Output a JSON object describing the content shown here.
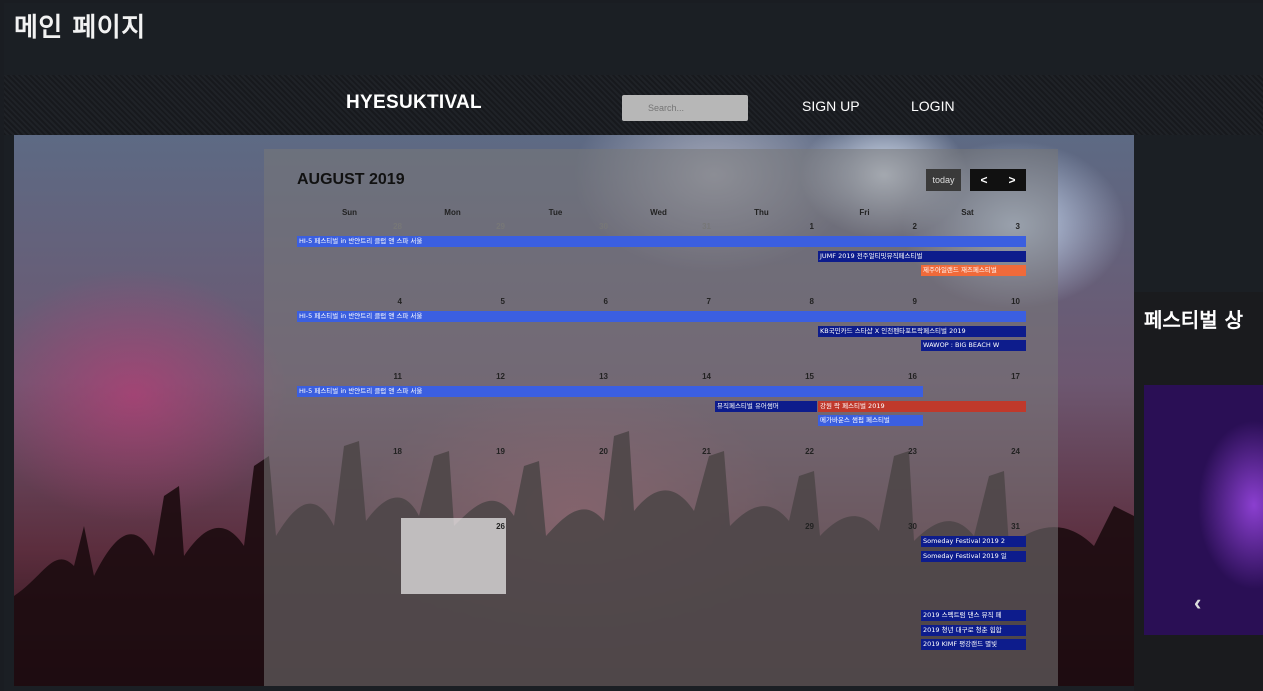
{
  "page": {
    "title": "메인 페이지"
  },
  "nav": {
    "brand": "HYESUKTIVAL",
    "search_placeholder": "Search...",
    "signup": "SIGN UP",
    "login": "LOGIN"
  },
  "calendar": {
    "title": "AUGUST 2019",
    "today_label": "today",
    "prev_label": "<",
    "next_label": ">",
    "weekdays": [
      "Sun",
      "Mon",
      "Tue",
      "Wed",
      "Thu",
      "Fri",
      "Sat"
    ],
    "weeks": [
      [
        "28",
        "29",
        "30",
        "31",
        "1",
        "2",
        "3"
      ],
      [
        "4",
        "5",
        "6",
        "7",
        "8",
        "9",
        "10"
      ],
      [
        "11",
        "12",
        "13",
        "14",
        "15",
        "16",
        "17"
      ],
      [
        "18",
        "19",
        "20",
        "21",
        "22",
        "23",
        "24"
      ],
      [
        "",
        "26",
        "",
        "",
        "29",
        "30",
        "31"
      ]
    ],
    "events": {
      "hi5_w1": "HI-5 페스티벌 in 반얀트리 클럽 앤 스파 서울",
      "jimf_w1": "JUMF 2019 전주얼티밋뮤직페스티벌",
      "jeju_w1": "제주아일랜드 재즈페스티벌",
      "hi5_w2": "HI-5 페스티벌 in 반얀트리 클럽 앤 스파 서울",
      "kor_w2": "KB국민카드 스타샵 X 인천펜타포트락페스티벌 2019",
      "wawop_w2": "WAWOP : BIG BEACH W",
      "hi5_w3": "HI-5 페스티벌 in 반얀트리 클럽 앤 스파 서울",
      "music_w3": "뮤직페스티벌 유어썸머",
      "gangwon_w3": "강원 락 페스티벌 2019",
      "mega_w3": "메가바운스 썸펍 페스티벌",
      "someday1": "Someday Festival 2019 2",
      "someday2": "Someday Festival 2019 일",
      "spectrum": "2019 스펙트럼 댄스 뮤직 페",
      "youth": "2019 청년 대구로 청춘 힙합",
      "kimf": "2019 KIMF 평강랜드 별빛"
    }
  },
  "side": {
    "title": "페스티벌 상",
    "prev_arrow": "‹"
  },
  "colors": {
    "event_blue": "#3b5fe0",
    "event_navy": "#0d1c8c",
    "event_orange": "#f06a3a",
    "event_red": "#c0392b"
  }
}
